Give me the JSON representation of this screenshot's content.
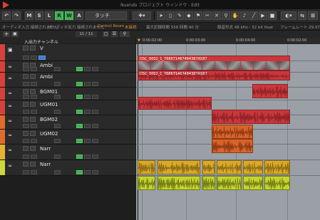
{
  "window": {
    "title": "Nuendo プロジェクト ウィンドウ - Edit"
  },
  "toolbar": {
    "undo_glyph": "↶",
    "redo_glyph": "↷",
    "m_label": "M",
    "s_label": "S",
    "l_label": "L",
    "r_label": "R",
    "w_label": "W",
    "a_label": "A",
    "preset_label": "タッチ",
    "icons": [
      "undo-icon",
      "redo-icon",
      "pointer-icon",
      "range-icon",
      "pencil-icon",
      "eraser-icon",
      "glue-icon",
      "scissors-icon",
      "mute-tool-icon",
      "zoom-icon",
      "play-icon",
      "color-icon",
      "snap-icon"
    ]
  },
  "infoline": {
    "items": [
      "オーディオ入力 接続されません",
      "オーディオ出力 接続されません",
      "Control Room",
      "未接続",
      "最大記録時間 558 時間 40 分",
      "録音形式 48 kHz - 32 bit float",
      "フレームレート 29.97 dfps"
    ]
  },
  "header": {
    "counter": "11 / 11",
    "input_output_label": "入出力チャンネル"
  },
  "ruler": {
    "marks": [
      "0:00:02:00",
      "0:00:02:00",
      "0:00:03:00",
      "0:00:04:00"
    ]
  },
  "tracks": [
    {
      "name": "V",
      "color": "#d8403a"
    },
    {
      "name": "Ambi",
      "color": "#d8403a"
    },
    {
      "name": "Ambi",
      "color": "#d8403a"
    },
    {
      "name": "BGM01",
      "color": "#d8403a"
    },
    {
      "name": "UGM01",
      "color": "#d8403a"
    },
    {
      "name": "BGM02",
      "color": "#e06c2c"
    },
    {
      "name": "UGM02",
      "color": "#e06c2c"
    },
    {
      "name": "Narr",
      "color": "#e7b231"
    },
    {
      "name": "Narr",
      "color": "#c9d83a"
    }
  ],
  "clips": {
    "video_label": "DSC_0002_1_768671467484387A587",
    "audio_label": "DSC_0002_1_768671467484387A587"
  },
  "colors": {
    "accent_green": "#3fae55",
    "track_red": "#d8403a",
    "track_orange": "#e06c2c",
    "track_yellow": "#e7b231",
    "track_lime": "#c9d83a",
    "arrange_bg": "#9aa0a6"
  }
}
